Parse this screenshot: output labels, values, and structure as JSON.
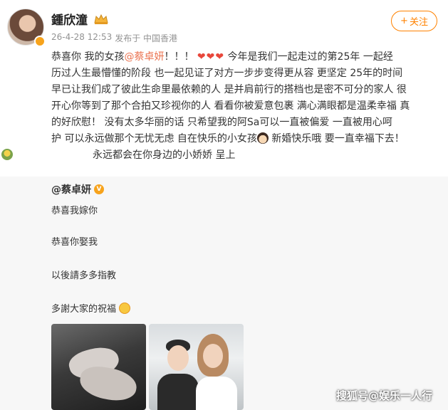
{
  "header": {
    "author_name": "鍾欣潼",
    "timestamp": "26-4-28 12:53",
    "source": "发布于 中国香港",
    "follow_label": "关注",
    "follow_icon": "+"
  },
  "post": {
    "line1_a": "恭喜你 我的女孩",
    "mention": "@蔡卓妍",
    "line1_b": "！！！",
    "hearts": "❤❤❤",
    "line1_c": " 今年是我们一起走过的第25年 一起经",
    "line2": "历过人生最懵懂的阶段 也一起见证了对方一步步变得更从容 更坚定  25年的时间",
    "line3": "早已让我们成了彼此生命里最依赖的人 是并肩前行的搭档也是密不可分的家人  很",
    "line4": "开心你等到了那个合拍又珍视你的人 看看你被爱意包裹 满心满眼都是温柔幸福 真",
    "line5": "的好欣慰！  没有太多华丽的话 只希望我的阿Sa可以一直被偏爱 一直被用心呵",
    "line6_a": "护 可以永远做那个无忧无虑 自在快乐的小女孩",
    "line6_b": " 新婚快乐哦 要一直幸福下去！",
    "line7": "永远都会在你身边的小娇娇 呈上"
  },
  "repost": {
    "author": "@蔡卓妍",
    "verified_mark": "V",
    "lines": [
      "恭喜我嫁你",
      "恭喜你娶我",
      "以後請多多指教",
      "多謝大家的祝福"
    ]
  },
  "watermark": "搜狐号@娱乐一人行",
  "colors": {
    "follow": "#ff8200",
    "mention": "#eb7350",
    "repost_bg": "#f7f7f7"
  }
}
